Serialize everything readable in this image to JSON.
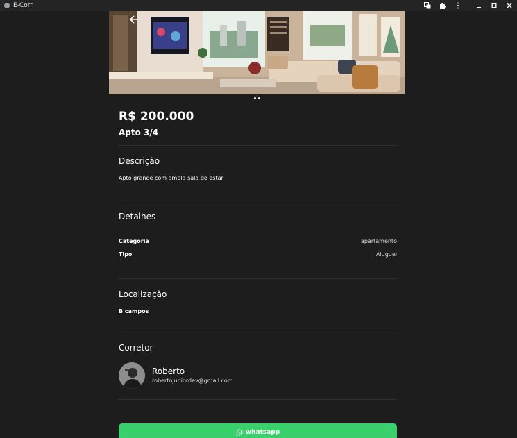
{
  "window": {
    "title": "E-Corr",
    "icons": [
      "translate-icon",
      "extension-icon",
      "more-vert-icon",
      "minimize-icon",
      "maximize-icon",
      "close-icon"
    ]
  },
  "hero": {
    "image_subject": "living room with tv and sofa",
    "carousel_page": 1,
    "carousel_total": 2
  },
  "listing": {
    "price": "R$ 200.000",
    "title": "Apto 3/4"
  },
  "description": {
    "heading": "Descrição",
    "text": "Apto grande com ampla sala de estar"
  },
  "details": {
    "heading": "Detalhes",
    "rows": [
      {
        "label": "Categoria",
        "value": "apartamento"
      },
      {
        "label": "Tipo",
        "value": "Aluguel"
      }
    ]
  },
  "location": {
    "heading": "Localização",
    "text": "B campos"
  },
  "broker": {
    "heading": "Corretor",
    "name": "Roberto",
    "email": "robertojuniordev@gmail.com"
  },
  "actions": {
    "whatsapp_label": "whatsapp",
    "whatsapp_color": "#3ad16c"
  },
  "colors": {
    "background": "#1d1d1d",
    "divider": "#2f3030",
    "text": "#ffffff"
  }
}
